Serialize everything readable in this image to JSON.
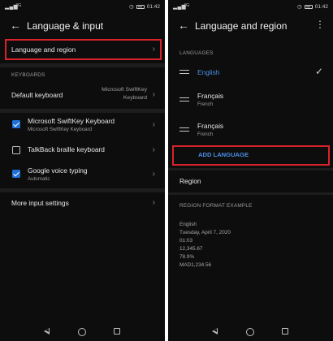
{
  "left": {
    "status": {
      "carrier": "4G",
      "time": "01:42",
      "battery": "▮"
    },
    "title": "Language & input",
    "language_row": "Language and region",
    "keyboards_header": "KEYBOARDS",
    "default_keyboard": {
      "label": "Default keyboard",
      "value_line1": "Microsoft SwiftKey",
      "value_line2": "Keyboard"
    },
    "keyboards": [
      {
        "label": "Microsoft SwiftKey Keyboard",
        "sub": "Microsoft SwiftKey Keyboard",
        "checked": true
      },
      {
        "label": "TalkBack braille keyboard",
        "sub": "",
        "checked": false
      },
      {
        "label": "Google voice typing",
        "sub": "Automatic",
        "checked": true
      }
    ],
    "more_input": "More input settings"
  },
  "right": {
    "status": {
      "carrier": "4G",
      "time": "01:42"
    },
    "title": "Language and region",
    "languages_header": "LANGUAGES",
    "languages": [
      {
        "name": "English",
        "sub": "",
        "selected": true
      },
      {
        "name": "Français",
        "sub": "French",
        "selected": false
      },
      {
        "name": "Français",
        "sub": "French",
        "selected": false
      }
    ],
    "add_language": "ADD LANGUAGE",
    "region_label": "Region",
    "region_header": "REGION FORMAT EXAMPLE",
    "example": [
      "English",
      "Tuesday, April 7, 2020",
      "01:03",
      "12,345.67",
      "78.9%",
      "MAD1,234.56"
    ]
  },
  "colors": {
    "accent": "#4a8fe7",
    "highlight": "#d9232b",
    "checkbox": "#1f6fd6"
  }
}
